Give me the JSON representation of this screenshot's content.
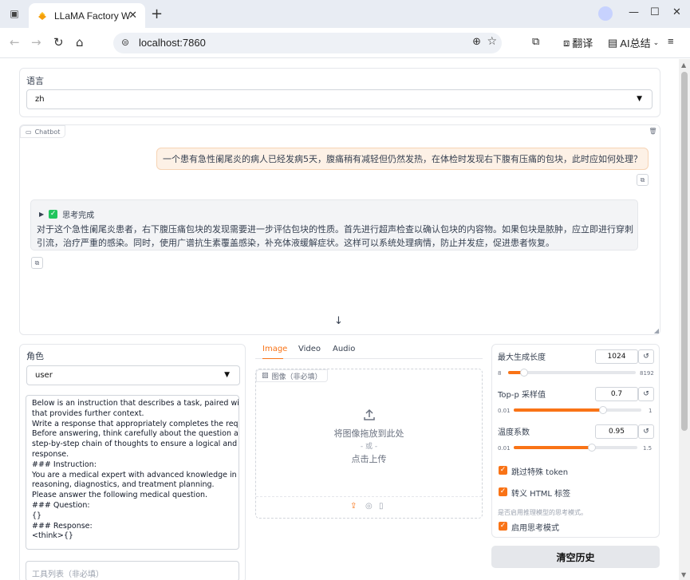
{
  "browser": {
    "tab_title": "LLaMA Factory W",
    "url": "localhost:7860",
    "translate_label": "翻译",
    "ai_summary_label": "AI总结"
  },
  "language": {
    "label": "语言",
    "value": "zh"
  },
  "chatbot": {
    "label": "Chatbot",
    "user_message": "一个患有急性阑尾炎的病人已经发病5天，腹痛稍有减轻但仍然发热，在体检时发现右下腹有压痛的包块，此时应如何处理？",
    "thinking_label": "思考完成",
    "bot_message": "对于这个急性阑尾炎患者，右下腹压痛包块的发现需要进一步评估包块的性质。首先进行超声检查以确认包块的内容物。如果包块是脓肿，应立即进行穿刺引流，治疗严重的感染。同时，使用广谱抗生素覆盖感染，补充体液缓解症状。这样可以系统处理病情，防止并发症，促进患者恢复。"
  },
  "role": {
    "label": "角色",
    "value": "user"
  },
  "system_prompt": {
    "lines": [
      "Below is an instruction that describes a task, paired with an input",
      "that provides further context.",
      "Write a response that appropriately completes the request.",
      "Before answering, think carefully about the question and create a",
      "step-by-step chain of thoughts to ensure a logical and accurate",
      "response.",
      "### Instruction:",
      "You are a medical expert with advanced knowledge in clinical",
      "reasoning, diagnostics, and treatment planning.",
      "Please answer the following medical question.",
      "### Question:",
      "{}",
      "### Response:",
      "<think>{}"
    ]
  },
  "tools_placeholder": "工具列表（非必填）",
  "media_tabs": [
    "Image",
    "Video",
    "Audio"
  ],
  "upload": {
    "tag": "图像（非必填）",
    "drop_text": "将图像拖放到此处",
    "or_text": "- 或 -",
    "click_text": "点击上传"
  },
  "params": {
    "max_tokens": {
      "label": "最大生成长度",
      "value": "1024",
      "min": "8",
      "max": "8192",
      "fraction": 0.124
    },
    "top_p": {
      "label": "Top-p 采样值",
      "value": "0.7",
      "min": "0.01",
      "max": "1",
      "fraction": 0.697
    },
    "temperature": {
      "label": "温度系数",
      "value": "0.95",
      "min": "0.01",
      "max": "1.5",
      "fraction": 0.631
    },
    "skip_special": "跳过特殊 token",
    "escape_html": "转义 HTML 标签",
    "thinking_hint": "是否启用推理模型的思考模式。",
    "enable_thinking": "启用思考模式"
  },
  "clear_button": "清空历史",
  "colors": {
    "accent": "#f97316",
    "bubble_user": "#fdf1e6"
  }
}
